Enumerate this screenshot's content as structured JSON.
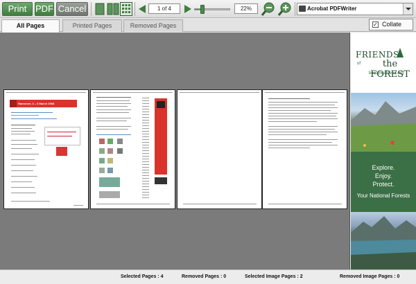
{
  "toolbar": {
    "print_label": "Print",
    "pdf_label": "PDF",
    "cancel_label": "Cancel",
    "page_indicator": "1 of 4",
    "zoom_value": "22%",
    "zoom_fraction": 0.22,
    "printer": "Acrobat PDFWriter",
    "accent_color": "#4f8a4f"
  },
  "tabs": [
    {
      "label": "All Pages",
      "active": true
    },
    {
      "label": "Printed Pages",
      "active": false
    },
    {
      "label": "Removed Pages",
      "active": false
    }
  ],
  "collate": {
    "label": "Collate",
    "checked": true,
    "mark": "✓"
  },
  "preview": {
    "pages": 4,
    "page1_banner": "Hannover, 4 – 6 March 2008"
  },
  "ad": {
    "logo_line1": "FRIENDS",
    "logo_line2": "the FOREST",
    "logo_small": "of",
    "logo_url": "becomeafriend.org",
    "lines": [
      "Explore.",
      "Enjoy.",
      "Protect.",
      "Your National Forests"
    ]
  },
  "status": {
    "selected_pages": "Selected Pages : 4",
    "removed_pages": "Removed Pages : 0",
    "selected_image_pages": "Selected Image Pages : 2",
    "removed_image_pages": "Removed Image Pages : 0"
  }
}
